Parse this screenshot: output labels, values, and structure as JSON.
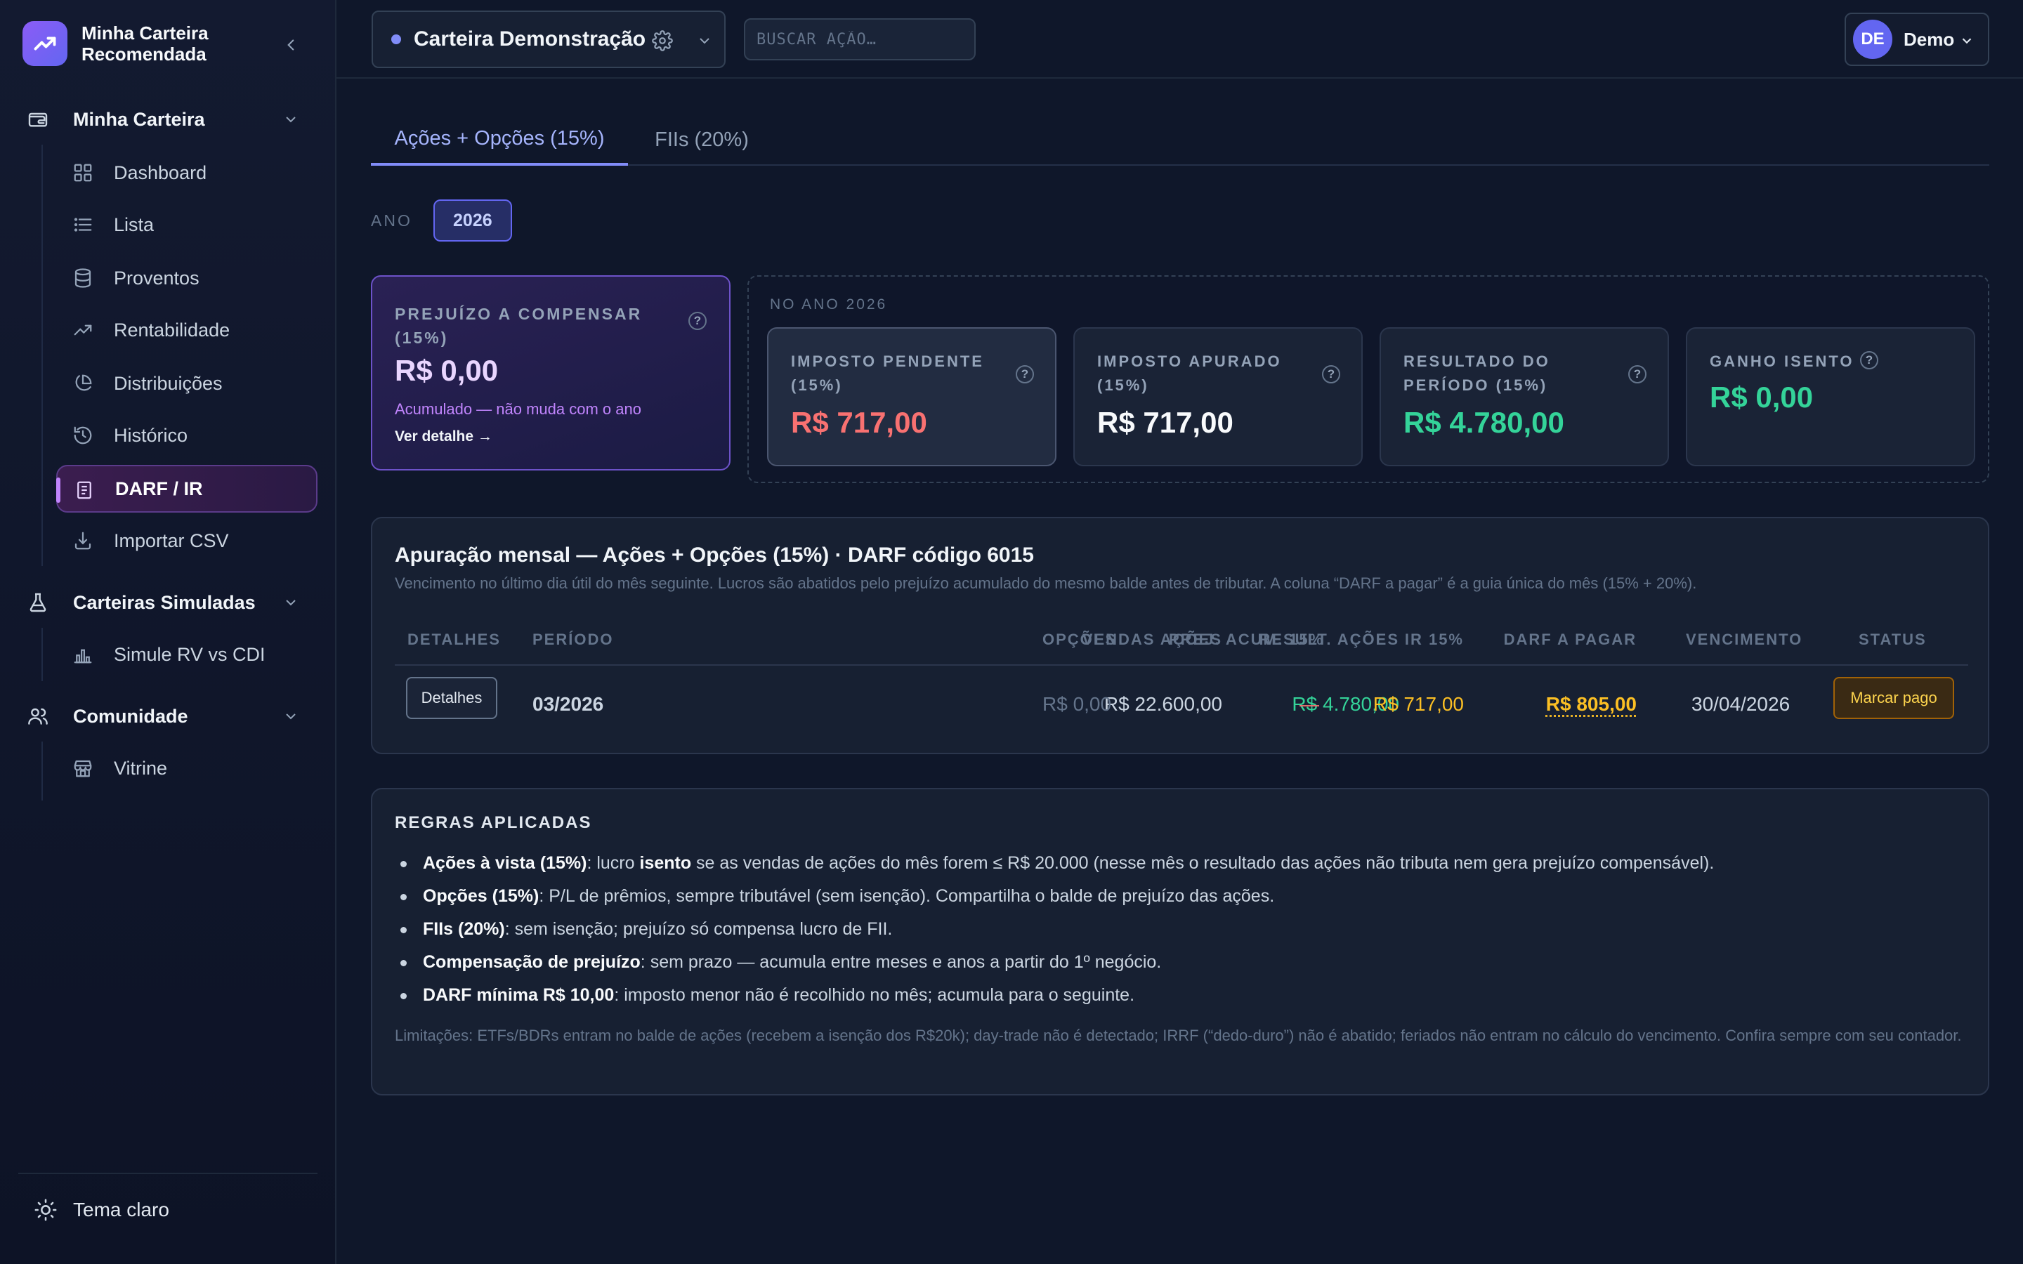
{
  "brand": {
    "line1": "Minha Carteira",
    "line2": "Recomendada"
  },
  "sidebar": {
    "groups": [
      {
        "label": "Minha Carteira",
        "items": [
          {
            "label": "Dashboard"
          },
          {
            "label": "Lista"
          },
          {
            "label": "Proventos"
          },
          {
            "label": "Rentabilidade"
          },
          {
            "label": "Distribuições"
          },
          {
            "label": "Histórico"
          },
          {
            "label": "DARF / IR",
            "active": true
          },
          {
            "label": "Importar CSV"
          }
        ]
      },
      {
        "label": "Carteiras Simuladas",
        "items": [
          {
            "label": "Simule RV vs CDI"
          }
        ]
      },
      {
        "label": "Comunidade",
        "items": [
          {
            "label": "Vitrine"
          }
        ]
      }
    ],
    "theme_toggle": "Tema claro"
  },
  "topbar": {
    "wallet_name": "Carteira Demonstração",
    "search_placeholder": "BUSCAR AÇÃO…",
    "user_initials": "DE",
    "user_name": "Demo"
  },
  "tabs": [
    {
      "label": "Ações + Opções (15%)",
      "active": true
    },
    {
      "label": "FIIs (20%)"
    }
  ],
  "year_filter": {
    "label": "ANO",
    "value": "2026"
  },
  "loss_card": {
    "label_line1": "PREJUÍZO A COMPENSAR",
    "label_line2": "(15%)",
    "value": "R$ 0,00",
    "note": "Acumulado — não muda com o ano",
    "link": "Ver detalhe →"
  },
  "year_box": {
    "title": "NO ANO 2026",
    "cards": [
      {
        "line1": "IMPOSTO PENDENTE",
        "line2": "(15%)",
        "value": "R$ 717,00",
        "color": "#f87171"
      },
      {
        "line1": "IMPOSTO APURADO",
        "line2": "(15%)",
        "value": "R$ 717,00",
        "color": "#f8fafc"
      },
      {
        "line1": "RESULTADO DO",
        "line2": "PERÍODO (15%)",
        "value": "R$ 4.780,00",
        "color": "#34d399"
      },
      {
        "line1": "GANHO ISENTO",
        "line2": "",
        "value": "R$ 0,00",
        "color": "#34d399"
      }
    ]
  },
  "monthly": {
    "title": "Apuração mensal — Ações + Opções (15%) · DARF código 6015",
    "subtitle": "Vencimento no último dia útil do mês seguinte. Lucros são abatidos pelo prejuízo acumulado do mesmo balde antes de tributar. A coluna “DARF a pagar” é a guia única do mês (15% + 20%).",
    "headers": [
      "DETALHES",
      "PERÍODO",
      "VENDAS AÇÕES",
      "RESULT. AÇÕES",
      "OPÇÕES",
      "PREJ. ACUM. 15%",
      "IR 15%",
      "DARF A PAGAR",
      "VENCIMENTO",
      "STATUS"
    ],
    "rows": [
      {
        "details_btn": "Detalhes",
        "period": "03/2026",
        "sales": "R$ 22.600,00",
        "result": "R$ 4.780,00",
        "options": "R$ 0,00",
        "loss": "—",
        "ir": "R$ 717,00",
        "darf": "R$ 805,00",
        "due": "30/04/2026",
        "status_btn": "Marcar pago"
      }
    ]
  },
  "rules": {
    "title": "REGRAS APLICADAS",
    "items": [
      {
        "b": "Ações à vista (15%)",
        "t1": ": lucro ",
        "b2": "isento",
        "t2": " se as vendas de ações do mês forem ≤ R$ 20.000 (nesse mês o resultado das ações não tributa nem gera prejuízo compensável)."
      },
      {
        "b": "Opções (15%)",
        "t1": ": P/L de prêmios, sempre tributável (sem isenção). Compartilha o balde de prejuízo das ações.",
        "b2": "",
        "t2": ""
      },
      {
        "b": "FIIs (20%)",
        "t1": ": sem isenção; prejuízo só compensa lucro de FII.",
        "b2": "",
        "t2": ""
      },
      {
        "b": "Compensação de prejuízo",
        "t1": ": sem prazo — acumula entre meses e anos a partir do 1º negócio.",
        "b2": "",
        "t2": ""
      },
      {
        "b": "DARF mínima R$ 10,00",
        "t1": ": imposto menor não é recolhido no mês; acumula para o seguinte.",
        "b2": "",
        "t2": ""
      }
    ],
    "limitations": "Limitações: ETFs/BDRs entram no balde de ações (recebem a isenção dos R$20k); day-trade não é detectado; IRRF (“dedo-duro”) não é abatido; feriados não entram no cálculo do vencimento. Confira sempre com seu contador."
  },
  "colors": {
    "accent": "#818cf8",
    "positive": "#34d399",
    "negative": "#f87171",
    "warning": "#fbbf24"
  }
}
